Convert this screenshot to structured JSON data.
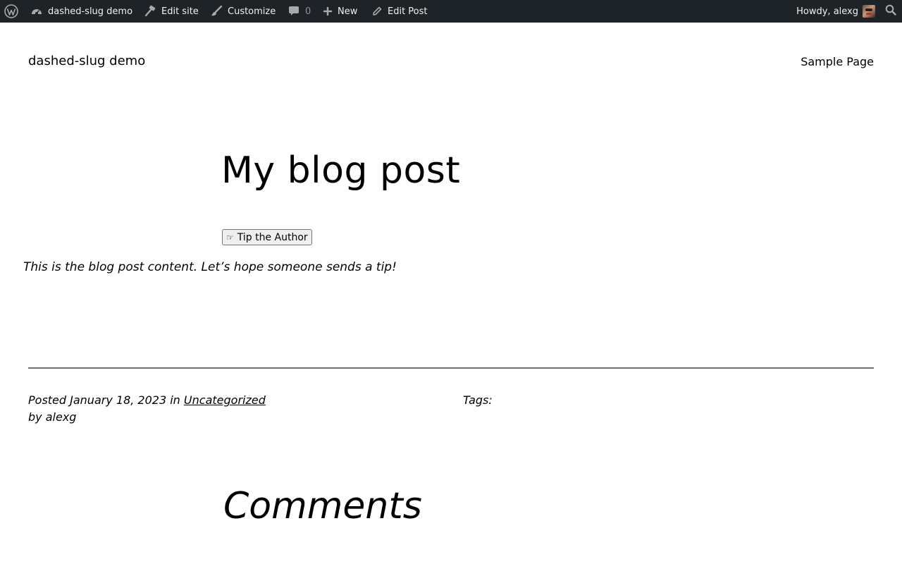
{
  "adminbar": {
    "wp_logo_icon": "wordpress-logo-icon",
    "site_name": "dashed-slug demo",
    "site_icon": "dashboard-icon",
    "edit_site": "Edit site",
    "edit_site_icon": "hammer-icon",
    "customize": "Customize",
    "customize_icon": "brush-icon",
    "comments_count": "0",
    "comments_icon": "comment-bubble-icon",
    "new_label": "New",
    "new_icon": "plus-icon",
    "edit_post": "Edit Post",
    "edit_post_icon": "pencil-icon",
    "howdy": "Howdy, alexg",
    "search_icon": "search-icon",
    "background_color": "#1d2327",
    "text_color": "#f0f0f1"
  },
  "site": {
    "title": "dashed-slug demo",
    "nav": [
      {
        "label": "Sample Page"
      }
    ]
  },
  "post": {
    "title": "My blog post",
    "tip_button": "Tip the Author",
    "tip_button_icon": "pointing-hand-icon",
    "content": "This is the blog post content. Let’s hope someone sends a tip!",
    "meta": {
      "posted_prefix": "Posted",
      "date": "January 18, 2023",
      "in_word": "in",
      "category": "Uncategorized",
      "by_prefix": "by",
      "author": "alexg",
      "tags_label": "Tags:"
    }
  },
  "comments": {
    "heading": "Comments"
  }
}
